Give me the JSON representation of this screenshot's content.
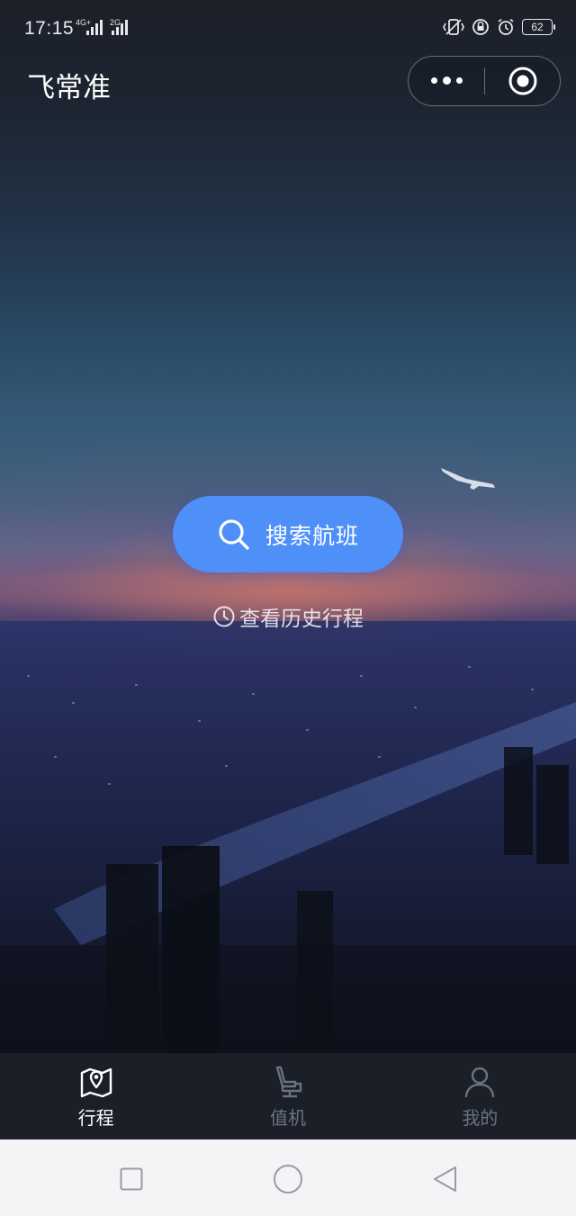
{
  "status_bar": {
    "time": "17:15",
    "sim1_tag": "4G+",
    "sim2_tag": "2G",
    "battery_level": "62",
    "icons": [
      "vibrate-icon",
      "lock-rotation-icon",
      "alarm-icon",
      "battery-icon"
    ]
  },
  "header": {
    "title": "飞常准",
    "capsule": {
      "more_icon": "more-dots-icon",
      "close_icon": "target-close-icon"
    }
  },
  "main": {
    "search_button": {
      "label": "搜索航班",
      "icon": "search-icon",
      "color": "#4e8ff8"
    },
    "history_link": {
      "label": "查看历史行程",
      "icon": "clock-icon"
    }
  },
  "tabbar": {
    "tabs": [
      {
        "label": "行程",
        "icon": "map-pin-icon",
        "active": true
      },
      {
        "label": "值机",
        "icon": "seat-icon",
        "active": false
      },
      {
        "label": "我的",
        "icon": "user-icon",
        "active": false
      }
    ],
    "active_color": "#ffffff",
    "inactive_color": "#6c7280"
  },
  "system_nav": {
    "buttons": [
      "recent-apps-icon",
      "home-icon",
      "back-icon"
    ]
  }
}
